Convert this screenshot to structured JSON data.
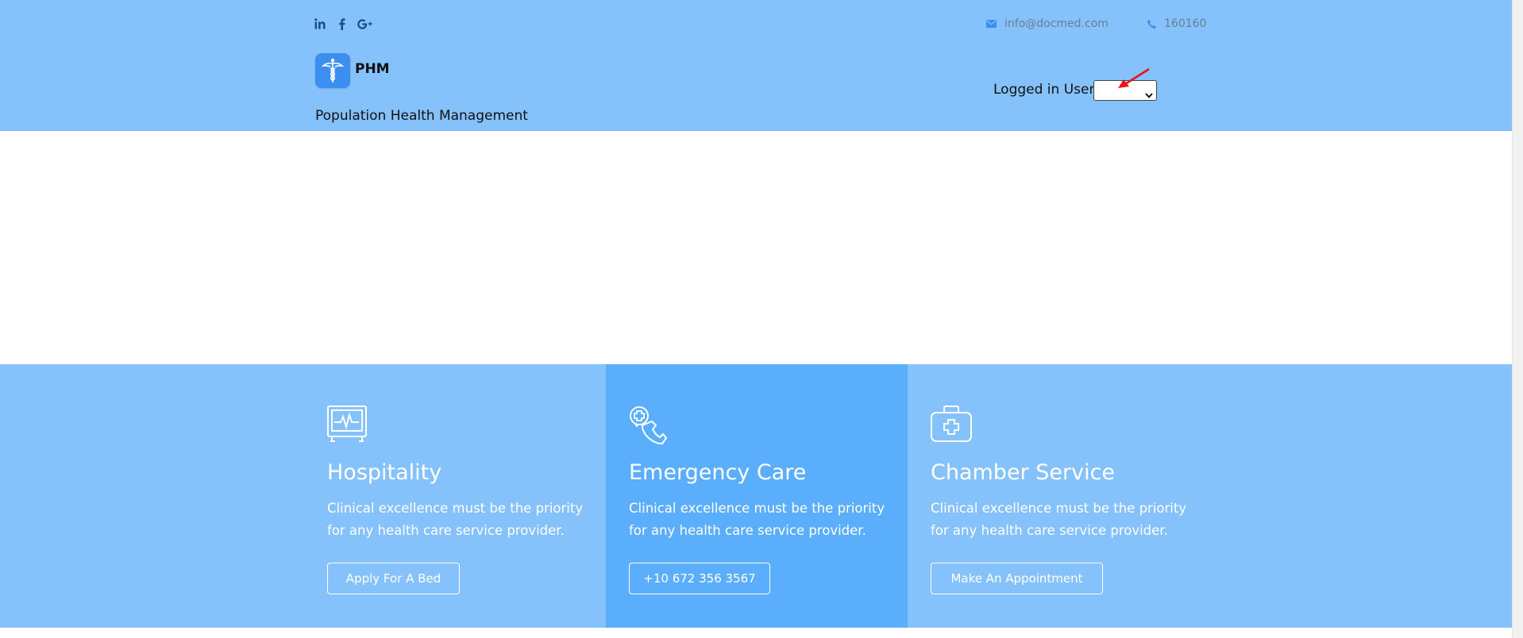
{
  "header": {
    "social_icons": [
      "linkedin-icon",
      "facebook-icon",
      "google-plus-icon"
    ],
    "email": {
      "icon": "envelope-icon",
      "text": "info@docmed.com"
    },
    "phone": {
      "icon": "phone-icon",
      "text": "160160"
    },
    "logo_icon": "caduceus-icon",
    "brand": "PHM",
    "tagline": "Population Health Management",
    "user_label": "Logged in User:",
    "user_select_value": ""
  },
  "features": [
    {
      "icon": "monitor-heartbeat-icon",
      "title": "Hospitality",
      "text": "Clinical excellence must be the priority for any health care service provider.",
      "button": "Apply For A Bed"
    },
    {
      "icon": "emergency-call-icon",
      "title": "Emergency Care",
      "text": "Clinical excellence must be the priority for any health care service provider.",
      "button": "+10 672 356 3567"
    },
    {
      "icon": "medical-kit-icon",
      "title": "Chamber Service",
      "text": "Clinical excellence must be the priority for any health care service provider.",
      "button": "Make An Appointment"
    }
  ],
  "colors": {
    "header_bg": "#85c1fb",
    "features_bg": "#85c1fb",
    "feature_highlight_bg": "#5aaefb",
    "logo_bg": "#3d8ef1",
    "contact_icon": "#3d8ef1",
    "arrow": "#e8141b"
  }
}
